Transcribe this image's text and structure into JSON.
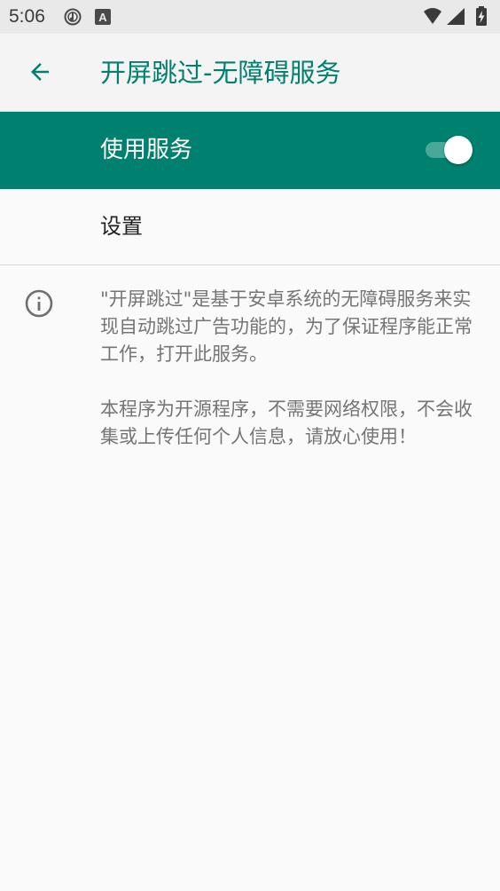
{
  "status_bar": {
    "time": "5:06",
    "icons": [
      "media-icon",
      "a-icon",
      "wifi-icon",
      "signal-icon",
      "battery-charging-icon"
    ]
  },
  "app_bar": {
    "back_icon": "arrow-back-icon",
    "title": "开屏跳过-无障碍服务"
  },
  "service": {
    "label": "使用服务",
    "enabled": true
  },
  "settings": {
    "label": "设置"
  },
  "info": {
    "icon": "info-icon",
    "paragraph1": "\"开屏跳过\"是基于安卓系统的无障碍服务来实现自动跳过广告功能的，为了保证程序能正常工作，打开此服务。",
    "paragraph2": "本程序为开源程序，不需要网络权限，不会收集或上传任何个人信息，请放心使用！"
  },
  "colors": {
    "accent": "#00806e",
    "title": "#00806d",
    "switch_track": "#4aa89a",
    "text_secondary": "#757575"
  }
}
